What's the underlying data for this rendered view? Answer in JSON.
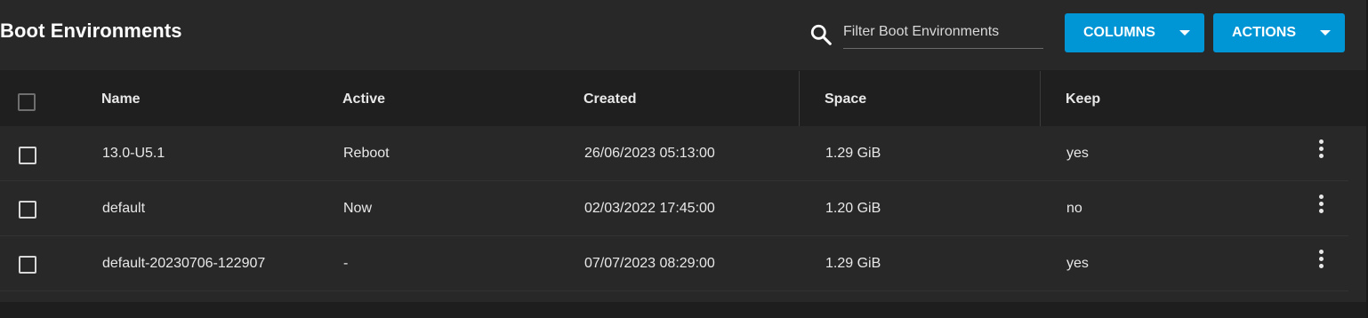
{
  "page": {
    "title": "Boot Environments"
  },
  "search": {
    "placeholder": "Filter Boot Environments",
    "value": ""
  },
  "toolbar": {
    "columns_label": "COLUMNS",
    "actions_label": "ACTIONS"
  },
  "table": {
    "columns": [
      "Name",
      "Active",
      "Created",
      "Space",
      "Keep"
    ],
    "rows": [
      {
        "name": "13.0-U5.1",
        "active": "Reboot",
        "created": "26/06/2023 05:13:00",
        "space": "1.29 GiB",
        "keep": "yes"
      },
      {
        "name": "default",
        "active": "Now",
        "created": "02/03/2022 17:45:00",
        "space": "1.20 GiB",
        "keep": "no"
      },
      {
        "name": "default-20230706-122907",
        "active": "-",
        "created": "07/07/2023 08:29:00",
        "space": "1.29 GiB",
        "keep": "yes"
      }
    ]
  },
  "icons": {
    "search": "search-icon",
    "dropdown": "caret-down-icon",
    "row_menu": "more-vert-icon"
  },
  "colors": {
    "accent": "#0095d5",
    "background": "#282828",
    "header_background": "#1f1f1f",
    "text": "#e8e8e8"
  }
}
